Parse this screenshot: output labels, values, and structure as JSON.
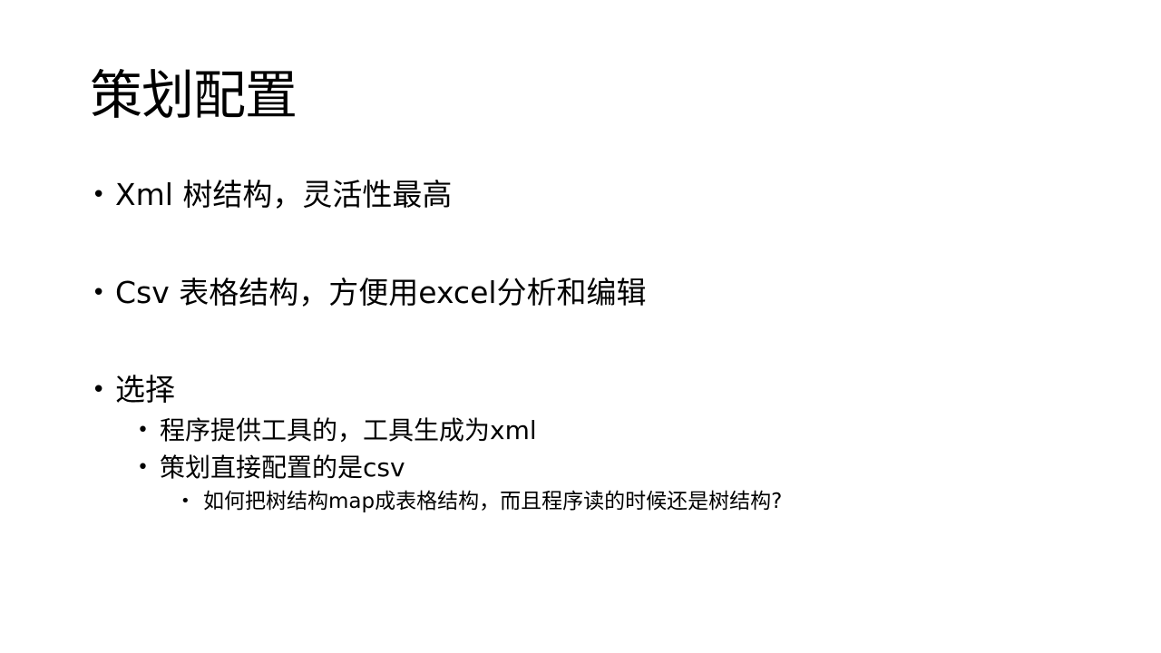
{
  "slide": {
    "title": "策划配置",
    "bullets": [
      {
        "level": 1,
        "text": "Xml  树结构，灵活性最高"
      },
      {
        "level": 1,
        "text": "Csv  表格结构，方便用excel分析和编辑"
      },
      {
        "level": 1,
        "text": "选择"
      },
      {
        "level": 2,
        "text": "程序提供工具的，工具生成为xml"
      },
      {
        "level": 2,
        "text": "策划直接配置的是csv"
      },
      {
        "level": 3,
        "text": "如何把树结构map成表格结构，而且程序读的时候还是树结构?"
      }
    ],
    "bullet_glyph": "•"
  }
}
